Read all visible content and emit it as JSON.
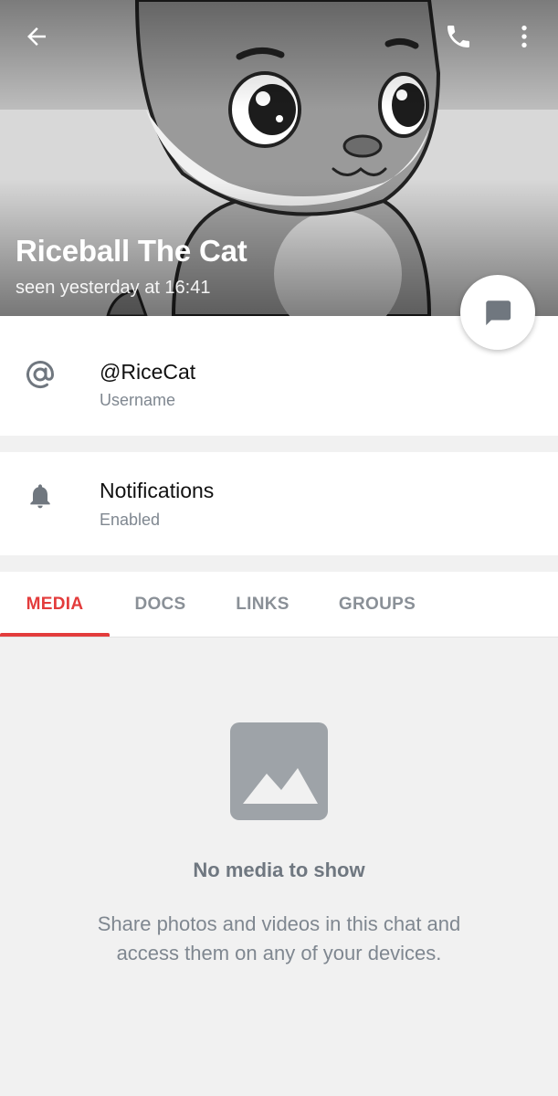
{
  "header": {
    "name": "Riceball The Cat",
    "status": "seen yesterday at 16:41"
  },
  "toolbar": {
    "back_icon": "arrow-left-icon",
    "call_icon": "phone-icon",
    "more_icon": "more-vertical-icon"
  },
  "fab": {
    "icon": "message-icon"
  },
  "info": {
    "username": {
      "value": "@RiceCat",
      "label": "Username",
      "icon": "at-sign-icon"
    },
    "notifications": {
      "value": "Notifications",
      "label": "Enabled",
      "icon": "bell-icon"
    }
  },
  "tabs": [
    {
      "label": "MEDIA",
      "active": true
    },
    {
      "label": "DOCS",
      "active": false
    },
    {
      "label": "LINKS",
      "active": false
    },
    {
      "label": "GROUPS",
      "active": false
    }
  ],
  "empty_state": {
    "icon": "image-icon",
    "title": "No media to show",
    "description": "Share photos and videos in this chat and access them on any of your devices."
  },
  "colors": {
    "accent": "#e33c3c",
    "secondary_text": "#7f8790",
    "background": "#f1f1f1",
    "icon_gray": "#70777f"
  }
}
